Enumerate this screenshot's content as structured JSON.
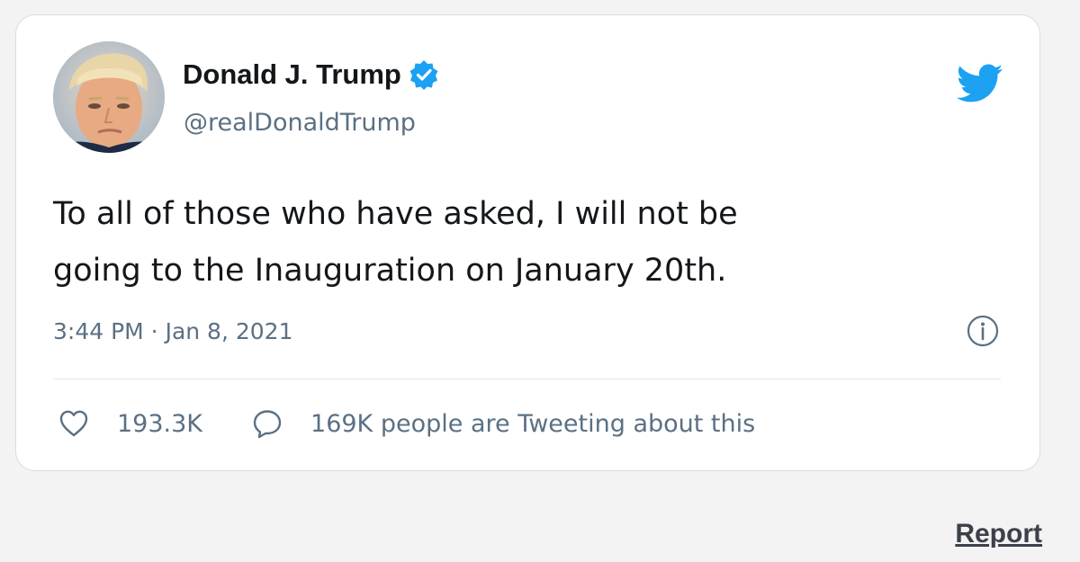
{
  "tweet": {
    "author": {
      "name": "Donald J. Trump",
      "handle": "@realDonaldTrump",
      "verified": true
    },
    "text": "To all of those who have asked, I will not be\ngoing to the Inauguration on January 20th.",
    "timestamp": "3:44 PM · Jan 8, 2021",
    "likes": "193.3K",
    "conversation": "169K people are Tweeting about this"
  },
  "footer": {
    "report_label": "Report"
  },
  "icons": {
    "brand": "twitter-bird-icon",
    "verified": "verified-badge-icon",
    "info": "info-icon",
    "like": "heart-icon",
    "reply": "speech-bubble-icon"
  },
  "colors": {
    "accent": "#1da1f2",
    "text": "#14171a",
    "muted": "#5b7083",
    "card_border": "#dcdcdc",
    "background": "#f3f3f3"
  }
}
